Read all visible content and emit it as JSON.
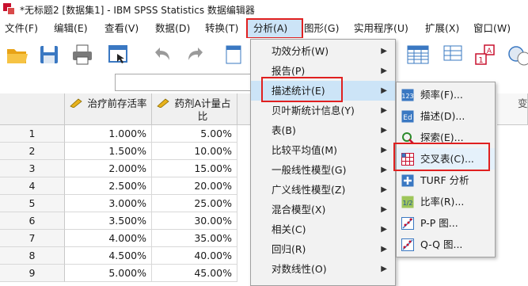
{
  "window": {
    "title": "*无标题2 [数据集1] - IBM SPSS Statistics 数据编辑器"
  },
  "menubar": {
    "items": [
      {
        "label": "文件(F)"
      },
      {
        "label": "编辑(E)"
      },
      {
        "label": "查看(V)"
      },
      {
        "label": "数据(D)"
      },
      {
        "label": "转换(T)"
      },
      {
        "label": "分析(A)"
      },
      {
        "label": "图形(G)"
      },
      {
        "label": "实用程序(U)"
      },
      {
        "label": "扩展(X)"
      },
      {
        "label": "窗口(W)"
      }
    ]
  },
  "analyze_menu": {
    "items": [
      {
        "label": "功效分析(W)"
      },
      {
        "label": "报告(P)"
      },
      {
        "label": "描述统计(E)"
      },
      {
        "label": "贝叶斯统计信息(Y)"
      },
      {
        "label": "表(B)"
      },
      {
        "label": "比较平均值(M)"
      },
      {
        "label": "一般线性模型(G)"
      },
      {
        "label": "广义线性模型(Z)"
      },
      {
        "label": "混合模型(X)"
      },
      {
        "label": "相关(C)"
      },
      {
        "label": "回归(R)"
      },
      {
        "label": "对数线性(O)"
      }
    ]
  },
  "descriptives_menu": {
    "items": [
      {
        "label": "频率(F)...",
        "icon": "frequencies-icon"
      },
      {
        "label": "描述(D)...",
        "icon": "descriptives-icon"
      },
      {
        "label": "探索(E)...",
        "icon": "explore-icon"
      },
      {
        "label": "交叉表(C)...",
        "icon": "crosstabs-icon"
      },
      {
        "label": "TURF 分析",
        "icon": "turf-icon"
      },
      {
        "label": "比率(R)...",
        "icon": "ratio-icon"
      },
      {
        "label": "P-P 图...",
        "icon": "pp-plot-icon"
      },
      {
        "label": "Q-Q 图...",
        "icon": "qq-plot-icon"
      }
    ]
  },
  "grid": {
    "columns": [
      {
        "header": "治疗前存活率"
      },
      {
        "header": "药剂A计量占比"
      }
    ],
    "partial_column_header": "变",
    "rows": [
      {
        "num": "1",
        "c1": "1.000%",
        "c2": "5.00%"
      },
      {
        "num": "2",
        "c1": "1.500%",
        "c2": "10.00%"
      },
      {
        "num": "3",
        "c1": "2.000%",
        "c2": "15.00%"
      },
      {
        "num": "4",
        "c1": "2.500%",
        "c2": "20.00%"
      },
      {
        "num": "5",
        "c1": "3.000%",
        "c2": "25.00%"
      },
      {
        "num": "6",
        "c1": "3.500%",
        "c2": "30.00%"
      },
      {
        "num": "7",
        "c1": "4.000%",
        "c2": "35.00%"
      },
      {
        "num": "8",
        "c1": "4.500%",
        "c2": "40.00%"
      },
      {
        "num": "9",
        "c1": "5.000%",
        "c2": "45.00%"
      }
    ]
  },
  "colors": {
    "highlight": "#cce4f7",
    "annotation_red": "#e02020"
  }
}
